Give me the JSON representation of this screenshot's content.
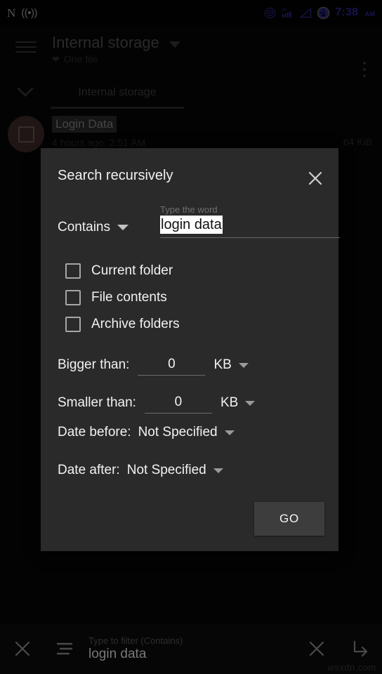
{
  "status_bar": {
    "nfc_label": "N",
    "cast_label": "((•))",
    "network_label": "4G",
    "battery_level": "39",
    "time": "7:38",
    "am_pm": "AM",
    "accent_color": "#3a36c8"
  },
  "app_bar": {
    "title": "Internal storage",
    "subtitle": "One file",
    "menu_icon": "hamburger-icon",
    "overflow_icon": "more-vertical-icon"
  },
  "tab_bar": {
    "expand_icon": "chevron-down-icon",
    "tabs": [
      {
        "label": "Internal storage",
        "selected": true
      }
    ]
  },
  "file_list": [
    {
      "name": "Login Data",
      "meta": "4 hours ago, 2:51 AM",
      "size": "64 KiB",
      "avatar_icon": "file-square-icon",
      "avatar_color": "#533a38"
    }
  ],
  "dialog": {
    "title": "Search recursively",
    "close_icon": "close-icon",
    "match_mode": {
      "selected": "Contains",
      "dropdown_icon": "chevron-down-icon"
    },
    "word_field": {
      "hint": "Type the word",
      "value": "login data",
      "selected": true
    },
    "checkboxes": [
      {
        "label": "Current folder",
        "checked": false
      },
      {
        "label": "File contents",
        "checked": false
      },
      {
        "label": "Archive folders",
        "checked": false
      }
    ],
    "size_filters": [
      {
        "label": "Bigger than:",
        "value": "0",
        "unit": "KB"
      },
      {
        "label": "Smaller than:",
        "value": "0",
        "unit": "KB"
      }
    ],
    "date_filters": [
      {
        "label": "Date before:",
        "value": "Not Specified"
      },
      {
        "label": "Date after:",
        "value": "Not Specified"
      }
    ],
    "submit_label": "GO"
  },
  "bottom_bar": {
    "close_icon": "close-icon",
    "filter_icon": "filter-lines-icon",
    "hint": "Type to filter (Contains)",
    "value": "login data",
    "clear_icon": "close-icon",
    "submit_icon": "subdirectory-arrow-right-icon"
  },
  "watermark": "wsxdn.com"
}
